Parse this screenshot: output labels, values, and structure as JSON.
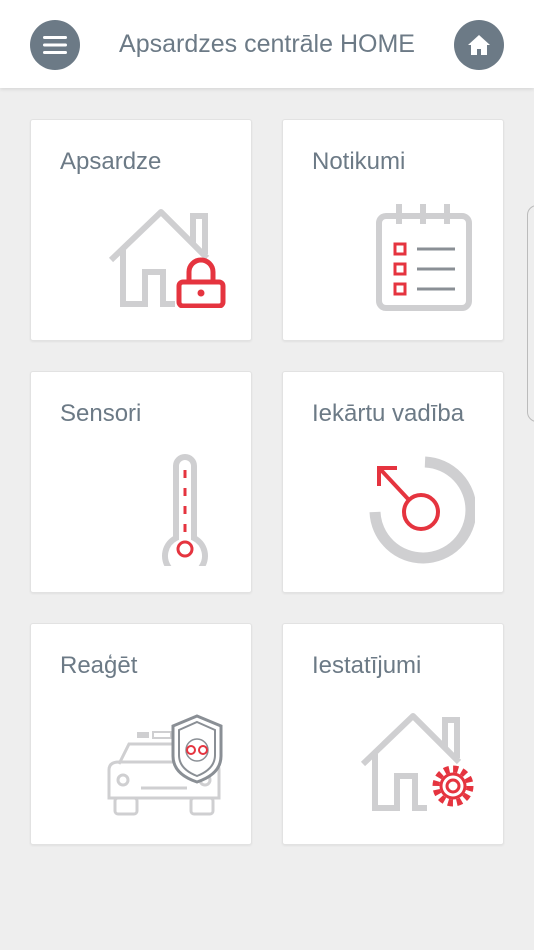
{
  "header": {
    "title": "Apsardzes centrāle HOME",
    "menu_icon": "hamburger-menu-icon",
    "home_icon": "home-icon"
  },
  "tiles": [
    {
      "label": "Apsardze",
      "icon": "house-lock-icon"
    },
    {
      "label": "Notikumi",
      "icon": "calendar-checklist-icon"
    },
    {
      "label": "Sensori",
      "icon": "thermometer-icon"
    },
    {
      "label": "Iekārtu vadība",
      "icon": "dial-control-icon"
    },
    {
      "label": "Reaģēt",
      "icon": "security-car-icon"
    },
    {
      "label": "Iestatījumi",
      "icon": "house-gear-icon"
    }
  ],
  "colors": {
    "accent": "#e5343f",
    "icon_gray": "#cfcfd1",
    "header_button": "#6c7a86",
    "text": "#6c7a86",
    "background": "#eeeeee"
  }
}
